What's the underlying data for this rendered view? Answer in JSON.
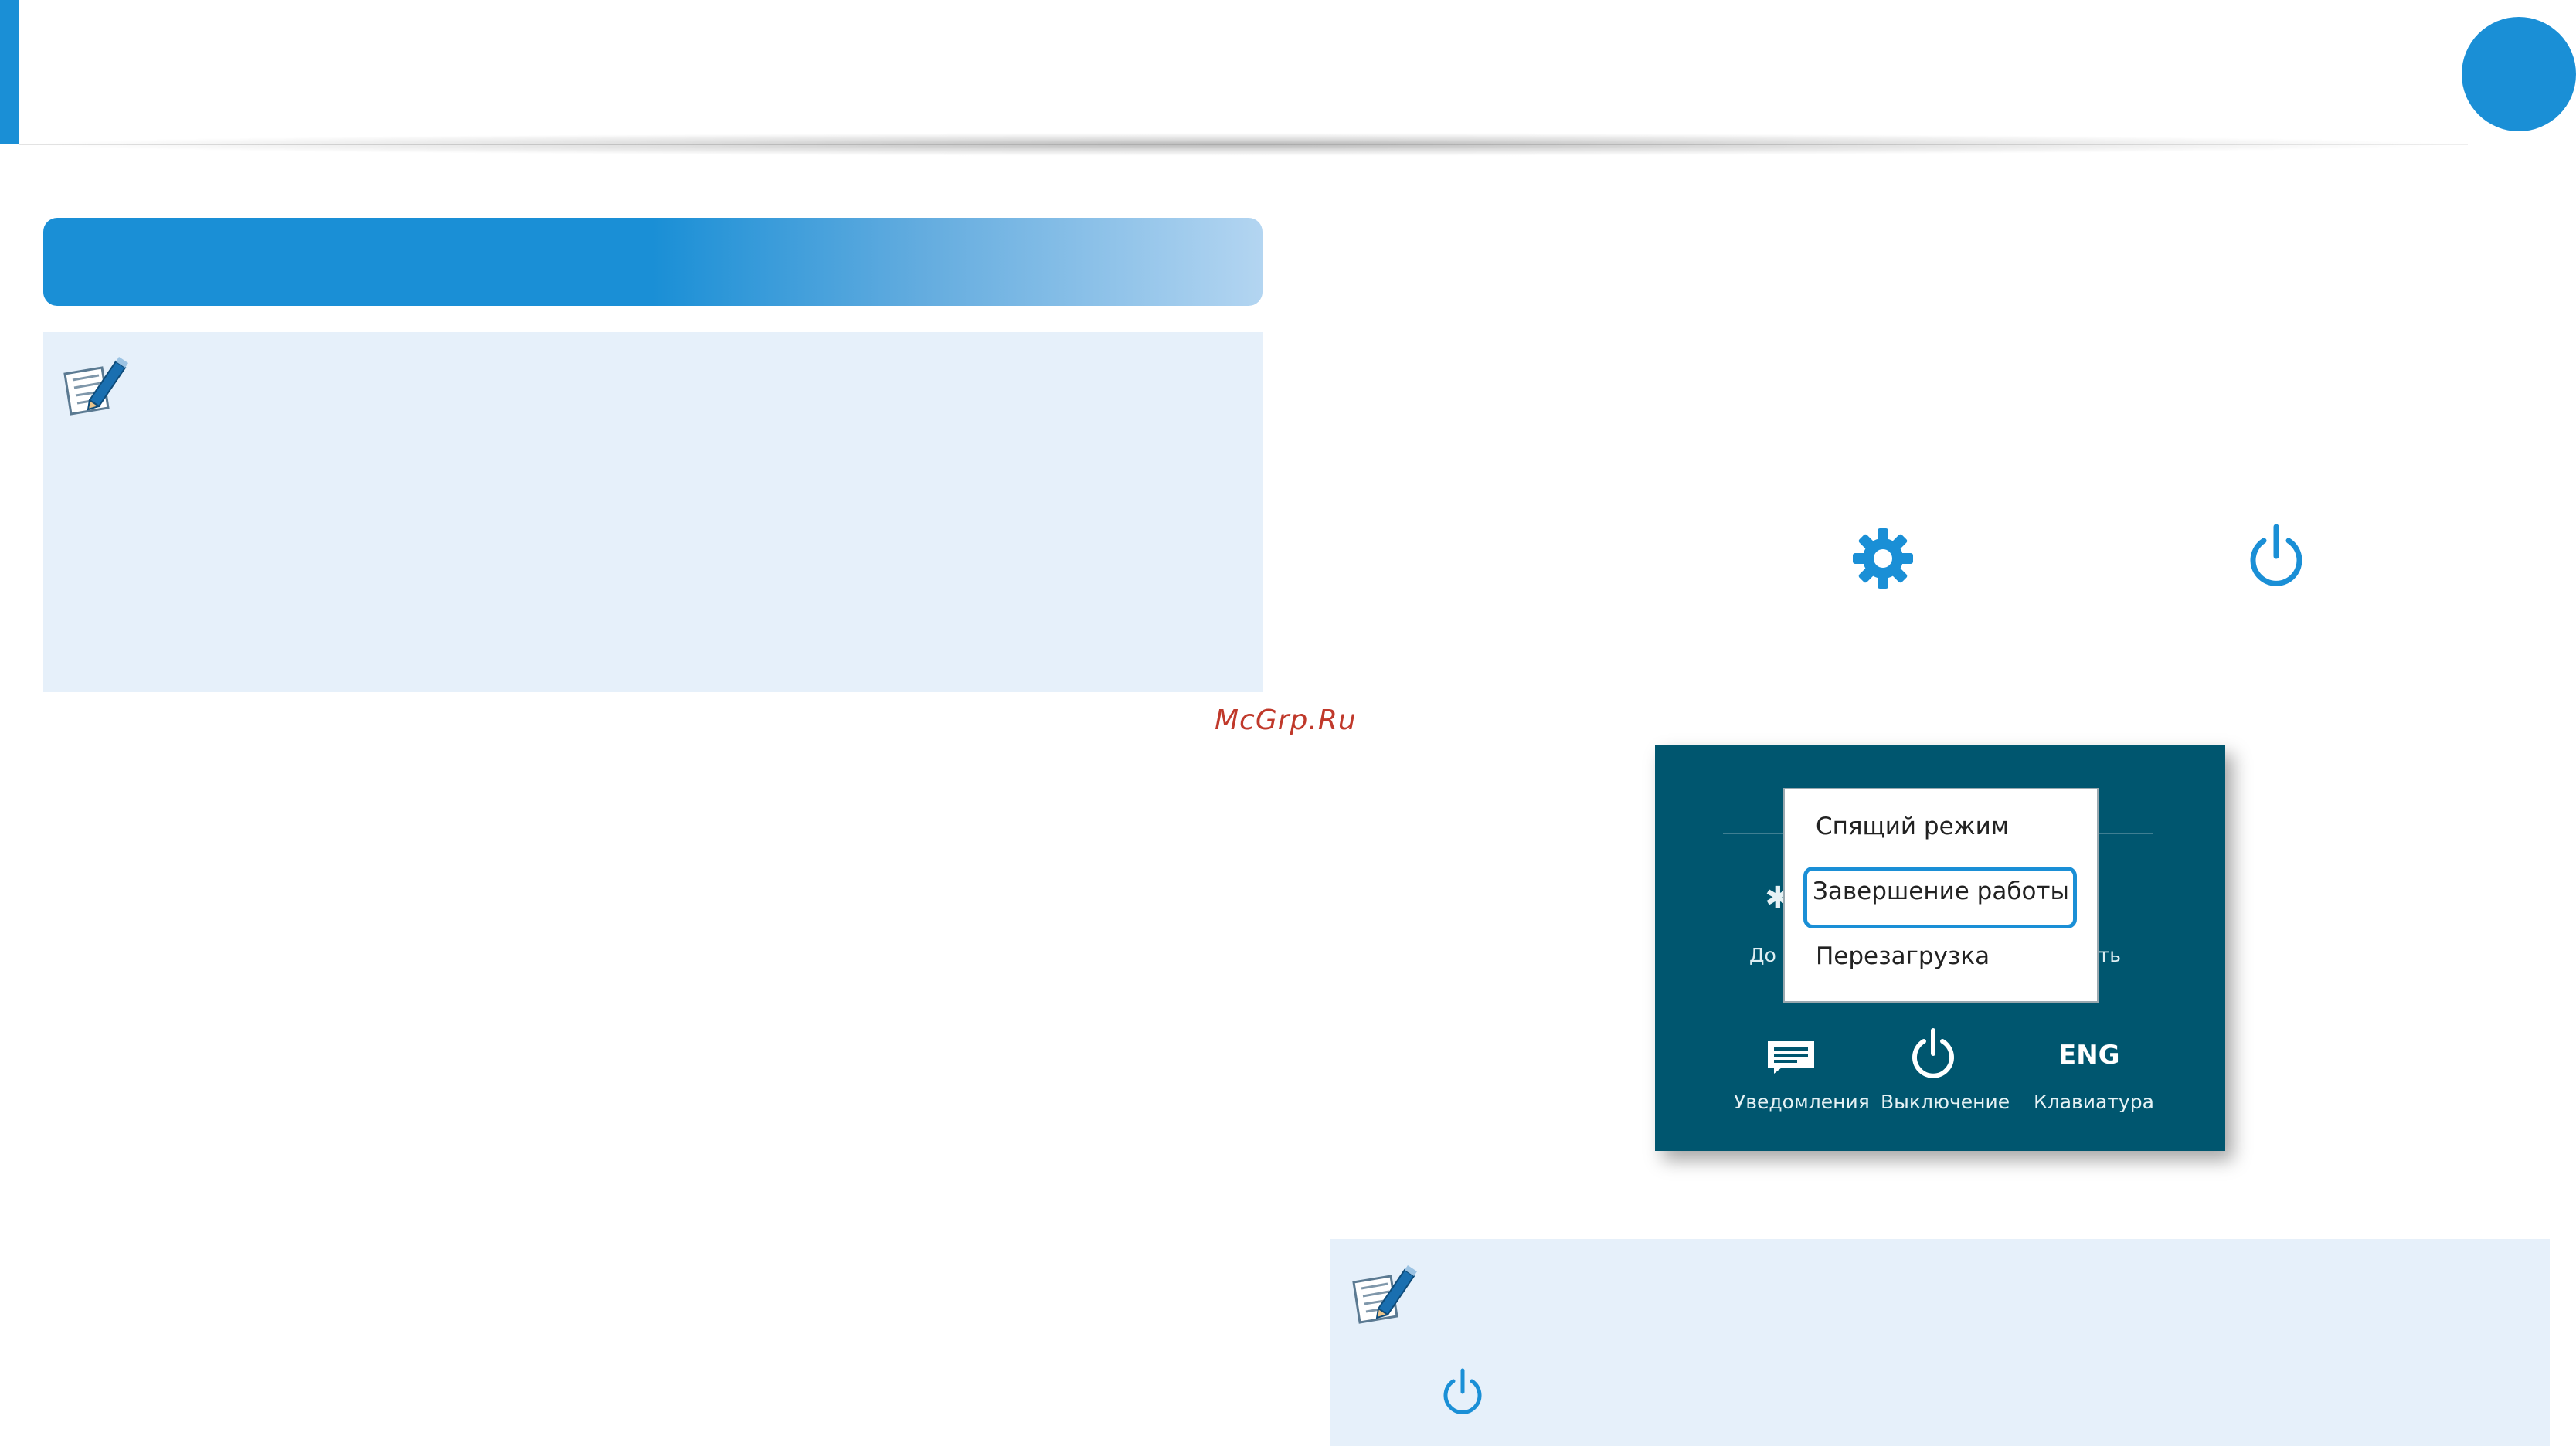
{
  "watermark": "McGrp.Ru",
  "icons": {
    "note_left": "memo-pencil-icon",
    "note_right": "memo-pencil-icon",
    "gear": "gear-icon",
    "power": "power-icon"
  },
  "colors": {
    "accent": "#1a8fd6",
    "note_background": "#e6f0fa",
    "panel_background": "#00566f",
    "watermark": "#c0392b"
  },
  "power_panel": {
    "menu": {
      "items": [
        "Спящий режим",
        "Завершение работы",
        "Перезагрузка"
      ],
      "highlighted": "Завершение работы"
    },
    "partial_left_label": "До",
    "partial_right_label": "сть",
    "bottom_items": [
      {
        "icon": "notifications-icon",
        "label": "Уведомления"
      },
      {
        "icon": "power-icon",
        "label": "Выключение"
      },
      {
        "icon_text": "ENG",
        "label": "Клавиатура"
      }
    ]
  }
}
